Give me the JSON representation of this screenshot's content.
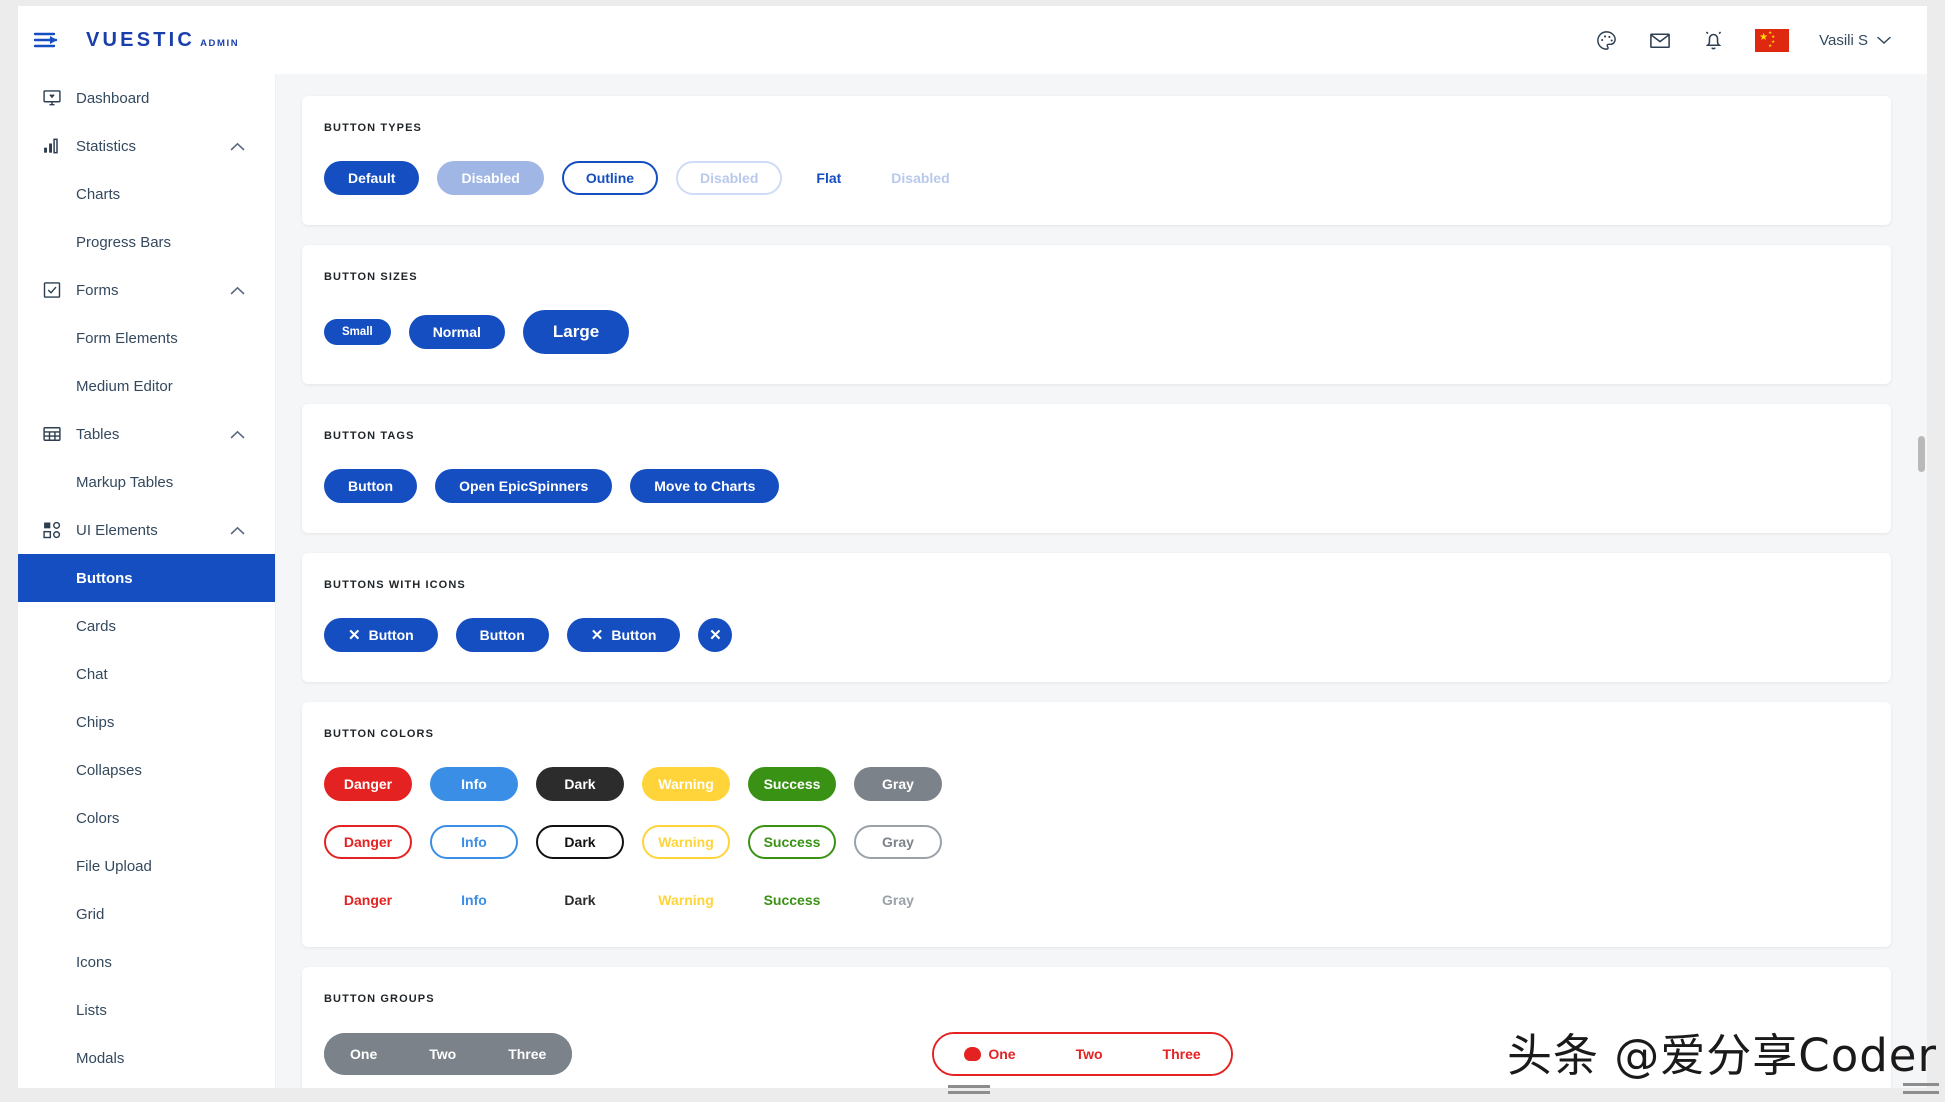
{
  "navbar": {
    "brand": "VUESTIC",
    "brand_sub": "ADMIN",
    "menu_icon": "hamburger-arrow-icon",
    "icons": [
      {
        "name": "palette-icon",
        "label": "Theme"
      },
      {
        "name": "mail-icon",
        "label": "Messages"
      },
      {
        "name": "bell-icon",
        "label": "Notifications"
      }
    ],
    "language_flag": "china-flag",
    "user_name": "Vasili S",
    "user_chevron": "chevron-down-icon"
  },
  "sidebar": {
    "items": [
      {
        "label": "Dashboard",
        "icon": "dashboard-icon",
        "type": "parent",
        "expandable": false,
        "active": false
      },
      {
        "label": "Statistics",
        "icon": "statistics-icon",
        "type": "parent",
        "expandable": true,
        "active": false
      },
      {
        "label": "Charts",
        "type": "child",
        "active": false
      },
      {
        "label": "Progress Bars",
        "type": "child",
        "active": false
      },
      {
        "label": "Forms",
        "icon": "forms-icon",
        "type": "parent",
        "expandable": true,
        "active": false
      },
      {
        "label": "Form Elements",
        "type": "child",
        "active": false
      },
      {
        "label": "Medium Editor",
        "type": "child",
        "active": false
      },
      {
        "label": "Tables",
        "icon": "tables-icon",
        "type": "parent",
        "expandable": true,
        "active": false
      },
      {
        "label": "Markup Tables",
        "type": "child",
        "active": false
      },
      {
        "label": "UI Elements",
        "icon": "ui-elements-icon",
        "type": "parent",
        "expandable": true,
        "active": false
      },
      {
        "label": "Buttons",
        "type": "child",
        "active": true
      },
      {
        "label": "Cards",
        "type": "child",
        "active": false
      },
      {
        "label": "Chat",
        "type": "child",
        "active": false
      },
      {
        "label": "Chips",
        "type": "child",
        "active": false
      },
      {
        "label": "Collapses",
        "type": "child",
        "active": false
      },
      {
        "label": "Colors",
        "type": "child",
        "active": false
      },
      {
        "label": "File Upload",
        "type": "child",
        "active": false
      },
      {
        "label": "Grid",
        "type": "child",
        "active": false
      },
      {
        "label": "Icons",
        "type": "child",
        "active": false
      },
      {
        "label": "Lists",
        "type": "child",
        "active": false
      },
      {
        "label": "Modals",
        "type": "child",
        "active": false
      }
    ]
  },
  "content": {
    "button_types": {
      "title": "BUTTON TYPES",
      "buttons": [
        {
          "label": "Default",
          "variant": "primary"
        },
        {
          "label": "Disabled",
          "variant": "disabled-solid"
        },
        {
          "label": "Outline",
          "variant": "outline"
        },
        {
          "label": "Disabled",
          "variant": "outline-disabled"
        },
        {
          "label": "Flat",
          "variant": "flat"
        },
        {
          "label": "Disabled",
          "variant": "flat-disabled"
        }
      ]
    },
    "button_sizes": {
      "title": "BUTTON SIZES",
      "buttons": [
        {
          "label": "Small",
          "size": "small"
        },
        {
          "label": "Normal",
          "size": "normal"
        },
        {
          "label": "Large",
          "size": "large"
        }
      ]
    },
    "button_tags": {
      "title": "BUTTON TAGS",
      "buttons": [
        {
          "label": "Button"
        },
        {
          "label": "Open EpicSpinners"
        },
        {
          "label": "Move to Charts"
        }
      ]
    },
    "buttons_with_icons": {
      "title": "BUTTONS WITH ICONS",
      "buttons": [
        {
          "label": "Button",
          "icon_left": "close-icon"
        },
        {
          "label": "Button"
        },
        {
          "label": "Button",
          "icon_left": "close-icon"
        },
        {
          "label": "",
          "icon_only": "close-icon"
        }
      ]
    },
    "button_colors": {
      "title": "BUTTON COLORS",
      "labels": [
        "Danger",
        "Info",
        "Dark",
        "Warning",
        "Success",
        "Gray"
      ],
      "hex": {
        "danger": "#e42222",
        "info": "#3a8ee6",
        "dark": "#2c2c2c",
        "warning": "#ffd43b",
        "success": "#3a9214",
        "gray": "#7b828a"
      },
      "variants": [
        "solid",
        "outline",
        "flat"
      ]
    },
    "button_groups": {
      "title": "BUTTON GROUPS",
      "left_group": [
        "One",
        "Two",
        "Three"
      ],
      "right_group": [
        "One",
        "Two",
        "Three"
      ],
      "right_group_icon": "brain-icon"
    }
  },
  "theme": {
    "primary": "#154ec1",
    "sidebar_active_bg": "#154ec1",
    "page_bg": "#f4f6f8"
  },
  "watermark": {
    "text": "头条 @爱分享Coder"
  }
}
